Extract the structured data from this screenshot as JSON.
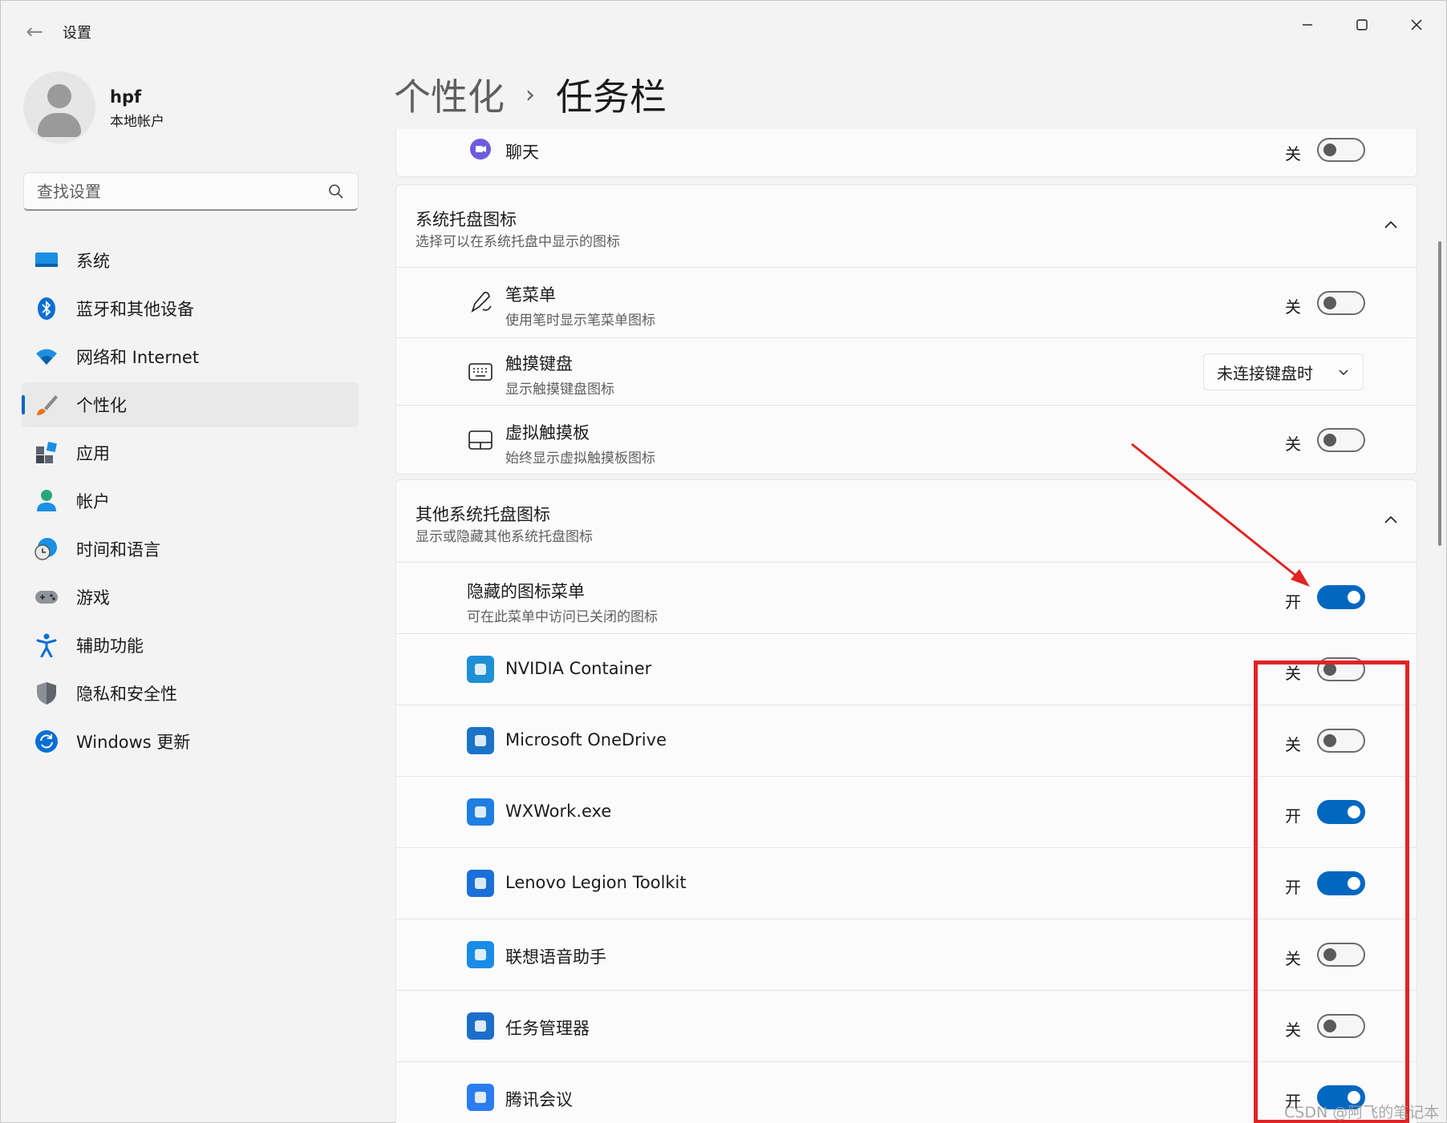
{
  "window": {
    "title": "设置",
    "controls": {
      "minimize": "—",
      "maximize": "☐",
      "close": "✕"
    }
  },
  "profile": {
    "name": "hpf",
    "account_type": "本地帐户"
  },
  "search": {
    "placeholder": "查找设置"
  },
  "nav": {
    "items": [
      {
        "label": "系统",
        "icon": "system-icon",
        "active": false
      },
      {
        "label": "蓝牙和其他设备",
        "icon": "bluetooth-icon",
        "active": false
      },
      {
        "label": "网络和 Internet",
        "icon": "wifi-icon",
        "active": false
      },
      {
        "label": "个性化",
        "icon": "brush-icon",
        "active": true
      },
      {
        "label": "应用",
        "icon": "apps-icon",
        "active": false
      },
      {
        "label": "帐户",
        "icon": "account-icon",
        "active": false
      },
      {
        "label": "时间和语言",
        "icon": "globe-clock-icon",
        "active": false
      },
      {
        "label": "游戏",
        "icon": "gamepad-icon",
        "active": false
      },
      {
        "label": "辅助功能",
        "icon": "accessibility-icon",
        "active": false
      },
      {
        "label": "隐私和安全性",
        "icon": "shield-icon",
        "active": false
      },
      {
        "label": "Windows 更新",
        "icon": "update-icon",
        "active": false
      }
    ]
  },
  "header": {
    "parent": "个性化",
    "separator": "›",
    "current": "任务栏"
  },
  "chat_row": {
    "title": "聊天",
    "state": "关",
    "on": false
  },
  "tray_section": {
    "title": "系统托盘图标",
    "subtitle": "选择可以在系统托盘中显示的图标",
    "rows": [
      {
        "title": "笔菜单",
        "subtitle": "使用笔时显示笔菜单图标",
        "state": "关",
        "on": false
      },
      {
        "title": "触摸键盘",
        "subtitle": "显示触摸键盘图标",
        "dropdown": "未连接键盘时"
      },
      {
        "title": "虚拟触摸板",
        "subtitle": "始终显示虚拟触摸板图标",
        "state": "关",
        "on": false
      }
    ]
  },
  "other_section": {
    "title": "其他系统托盘图标",
    "subtitle": "显示或隐藏其他系统托盘图标",
    "hidden_menu": {
      "title": "隐藏的图标菜单",
      "subtitle": "可在此菜单中访问已关闭的图标",
      "state": "开",
      "on": true
    },
    "apps": [
      {
        "name": "NVIDIA Container",
        "state": "关",
        "on": false,
        "color": "#1f8fd6"
      },
      {
        "name": "Microsoft OneDrive",
        "state": "关",
        "on": false,
        "color": "#1a73c7"
      },
      {
        "name": "WXWork.exe",
        "state": "开",
        "on": true,
        "color": "#1e7fe0"
      },
      {
        "name": "Lenovo Legion Toolkit",
        "state": "开",
        "on": true,
        "color": "#1b6fd8"
      },
      {
        "name": "联想语音助手",
        "state": "关",
        "on": false,
        "color": "#1a8be6"
      },
      {
        "name": "任务管理器",
        "state": "关",
        "on": false,
        "color": "#1c6fc9"
      },
      {
        "name": "腾讯会议",
        "state": "开",
        "on": true,
        "color": "#2b7cf0"
      }
    ]
  },
  "watermark": "CSDN @阿飞的笔记本",
  "colors": {
    "accent": "#0067c0",
    "annotation": "#e02424"
  }
}
